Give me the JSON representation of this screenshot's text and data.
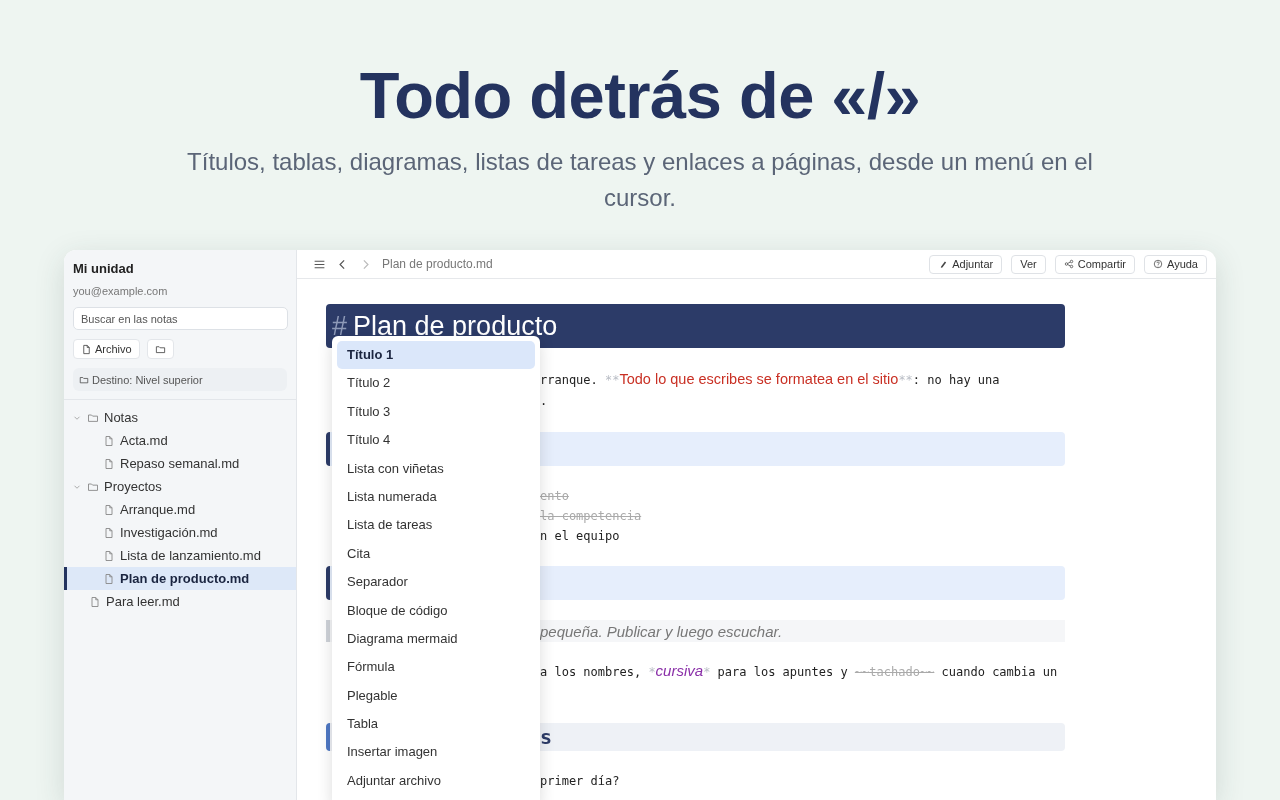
{
  "hero": {
    "title": "Todo detrás de «/»",
    "subtitle": "Títulos, tablas, diagramas, listas de tareas y enlaces a páginas, desde un menú en el cursor."
  },
  "sidebar": {
    "title": "Mi unidad",
    "email": "you@example.com",
    "search": {
      "placeholder": "Buscar en las notas"
    },
    "buttons": [
      {
        "kind": "file",
        "label": "Archivo"
      },
      {
        "kind": "folder"
      }
    ],
    "destination": "Destino: Nivel superior",
    "tree": [
      {
        "kind": "folder",
        "label": "Notas",
        "expanded": true,
        "selected": false,
        "children": [
          {
            "kind": "file",
            "label": "Acta.md",
            "selected": false
          },
          {
            "kind": "file",
            "label": "Repaso semanal.md",
            "selected": false
          }
        ]
      },
      {
        "kind": "folder",
        "label": "Proyectos",
        "expanded": true,
        "selected": false,
        "children": [
          {
            "kind": "file",
            "label": "Arranque.md",
            "selected": false
          },
          {
            "kind": "file",
            "label": "Investigación.md",
            "selected": false
          },
          {
            "kind": "file",
            "label": "Lista de lanzamiento.md",
            "selected": false
          },
          {
            "kind": "file",
            "label": "Plan de producto.md",
            "selected": true
          }
        ]
      },
      {
        "kind": "file",
        "label": "Para leer.md",
        "selected": false
      }
    ]
  },
  "toolbar": {
    "forward_disabled": true,
    "breadcrumb": "Plan de producto.md",
    "buttons": [
      {
        "kind": "attach",
        "label": "Adjuntar"
      },
      {
        "kind": "plain",
        "label": "Ver"
      },
      {
        "kind": "share",
        "label": "Compartir"
      },
      {
        "kind": "help",
        "label": "Ayuda"
      }
    ]
  },
  "editor": {
    "blocks": [
      {
        "kind": "h1",
        "marker": "#",
        "text": "Plan de producto"
      },
      {
        "kind": "para",
        "lines": [
          [
            {
              "kind": "plain",
              "text": "rranque. "
            },
            {
              "kind": "marker",
              "text": "**"
            },
            {
              "kind": "strong",
              "text": "Todo lo que escribes se formatea en el sitio"
            },
            {
              "kind": "marker",
              "text": "**"
            },
            {
              "kind": "plain",
              "text": ": no hay una"
            }
          ],
          [
            {
              "kind": "plain",
              "text": "."
            }
          ]
        ]
      },
      {
        "kind": "h2"
      },
      {
        "kind": "list",
        "lines": [
          [
            {
              "kind": "strike",
              "text": "ento"
            }
          ],
          [
            {
              "kind": "strike",
              "text": "la competencia"
            }
          ],
          [
            {
              "kind": "plain",
              "text": "n el equipo"
            }
          ]
        ]
      },
      {
        "kind": "h2"
      },
      {
        "kind": "quote",
        "text": "pequeña. Publicar y luego escuchar."
      },
      {
        "kind": "para",
        "lines": [
          [
            {
              "kind": "plain",
              "text": "a los nombres, "
            },
            {
              "kind": "marker",
              "text": "*"
            },
            {
              "kind": "em",
              "text": "cursiva"
            },
            {
              "kind": "marker",
              "text": "*"
            },
            {
              "kind": "plain",
              "text": " para los apuntes y "
            },
            {
              "kind": "strike",
              "text": "~~tachado~~"
            },
            {
              "kind": "plain",
              "text": " cuando cambia un"
            }
          ]
        ]
      },
      {
        "kind": "h3",
        "text": "s"
      },
      {
        "kind": "para",
        "lines": [
          [
            {
              "kind": "plain",
              "text": "primer día?"
            }
          ]
        ]
      }
    ]
  },
  "slash_menu": {
    "items": [
      {
        "label": "Título 1",
        "selected": true
      },
      {
        "label": "Título 2",
        "selected": false
      },
      {
        "label": "Título 3",
        "selected": false
      },
      {
        "label": "Título 4",
        "selected": false
      },
      {
        "label": "Lista con viñetas",
        "selected": false
      },
      {
        "label": "Lista numerada",
        "selected": false
      },
      {
        "label": "Lista de tareas",
        "selected": false
      },
      {
        "label": "Cita",
        "selected": false
      },
      {
        "label": "Separador",
        "selected": false
      },
      {
        "label": "Bloque de código",
        "selected": false
      },
      {
        "label": "Diagrama mermaid",
        "selected": false
      },
      {
        "label": "Fórmula",
        "selected": false
      },
      {
        "label": "Plegable",
        "selected": false
      },
      {
        "label": "Tabla",
        "selected": false
      },
      {
        "label": "Insertar imagen",
        "selected": false
      },
      {
        "label": "Adjuntar archivo",
        "selected": false
      }
    ]
  }
}
